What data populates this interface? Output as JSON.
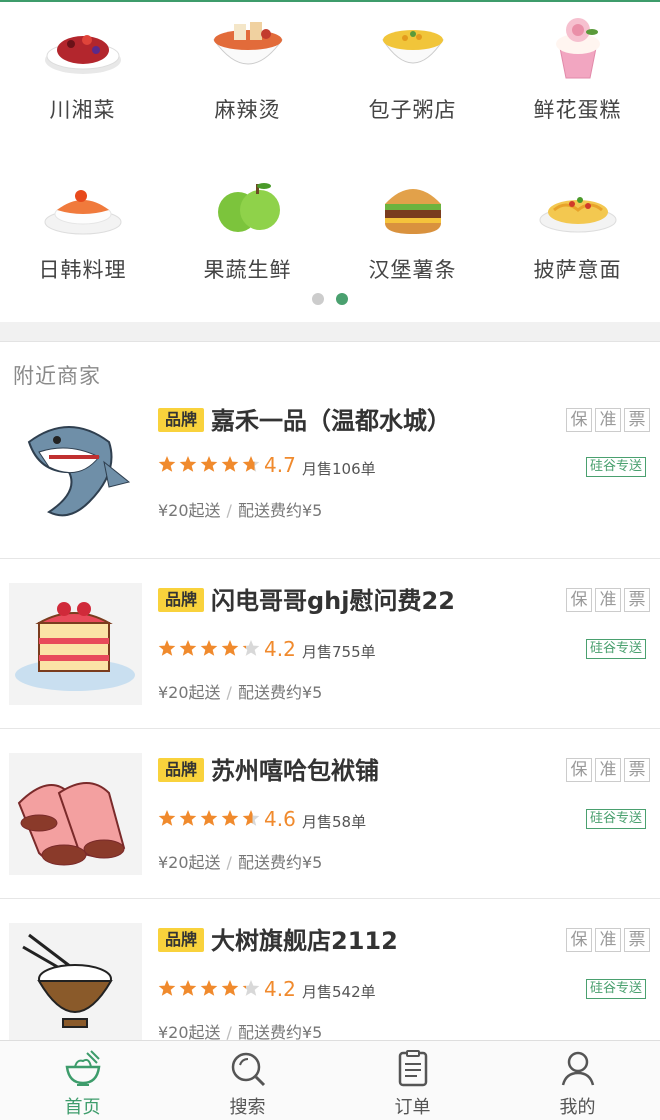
{
  "categories": [
    {
      "label": "川湘菜",
      "icon": "spicy-dish-icon"
    },
    {
      "label": "麻辣烫",
      "icon": "hotpot-bowl-icon"
    },
    {
      "label": "包子粥店",
      "icon": "porridge-bowl-icon"
    },
    {
      "label": "鲜花蛋糕",
      "icon": "cupcake-icon"
    },
    {
      "label": "日韩料理",
      "icon": "sushi-icon"
    },
    {
      "label": "果蔬生鲜",
      "icon": "green-apple-icon"
    },
    {
      "label": "汉堡薯条",
      "icon": "burger-icon"
    },
    {
      "label": "披萨意面",
      "icon": "pasta-icon"
    }
  ],
  "pager": {
    "pages": 2,
    "active": 2
  },
  "section_title": "附近商家",
  "shops": [
    {
      "brand": "品牌",
      "name": "嘉禾一品（温都水城）",
      "guarantees": [
        "保",
        "准",
        "票"
      ],
      "rating_value": 4.7,
      "rating": "4.7",
      "sales": "月售106单",
      "delivery": "硅谷专送",
      "min_order": "¥20起送",
      "fee": "配送费约¥5",
      "thumb": "shark-icon"
    },
    {
      "brand": "品牌",
      "name": "闪电哥哥ghj慰问费22",
      "guarantees": [
        "保",
        "准",
        "票"
      ],
      "rating_value": 4.2,
      "rating": "4.2",
      "sales": "月售755单",
      "delivery": "硅谷专送",
      "min_order": "¥20起送",
      "fee": "配送费约¥5",
      "thumb": "cake-slice-icon"
    },
    {
      "brand": "品牌",
      "name": "苏州嘻哈包袱铺",
      "guarantees": [
        "保",
        "准",
        "票"
      ],
      "rating_value": 4.6,
      "rating": "4.6",
      "sales": "月售58单",
      "delivery": "硅谷专送",
      "min_order": "¥20起送",
      "fee": "配送费约¥5",
      "thumb": "rolls-icon"
    },
    {
      "brand": "品牌",
      "name": "大树旗舰店2112",
      "guarantees": [
        "保",
        "准",
        "票"
      ],
      "rating_value": 4.2,
      "rating": "4.2",
      "sales": "月售542单",
      "delivery": "硅谷专送",
      "min_order": "¥20起送",
      "fee": "配送费约¥5",
      "thumb": "rice-bowl-icon"
    }
  ],
  "nav": [
    {
      "label": "首页",
      "icon": "home-bowl-icon",
      "active": true
    },
    {
      "label": "搜索",
      "icon": "search-icon",
      "active": false
    },
    {
      "label": "订单",
      "icon": "order-list-icon",
      "active": false
    },
    {
      "label": "我的",
      "icon": "user-icon",
      "active": false
    }
  ],
  "colors": {
    "accent": "#3d9c6b",
    "brand_tag": "#f9d23c",
    "star": "#f08a2d",
    "star_empty": "#d8d8d8"
  }
}
